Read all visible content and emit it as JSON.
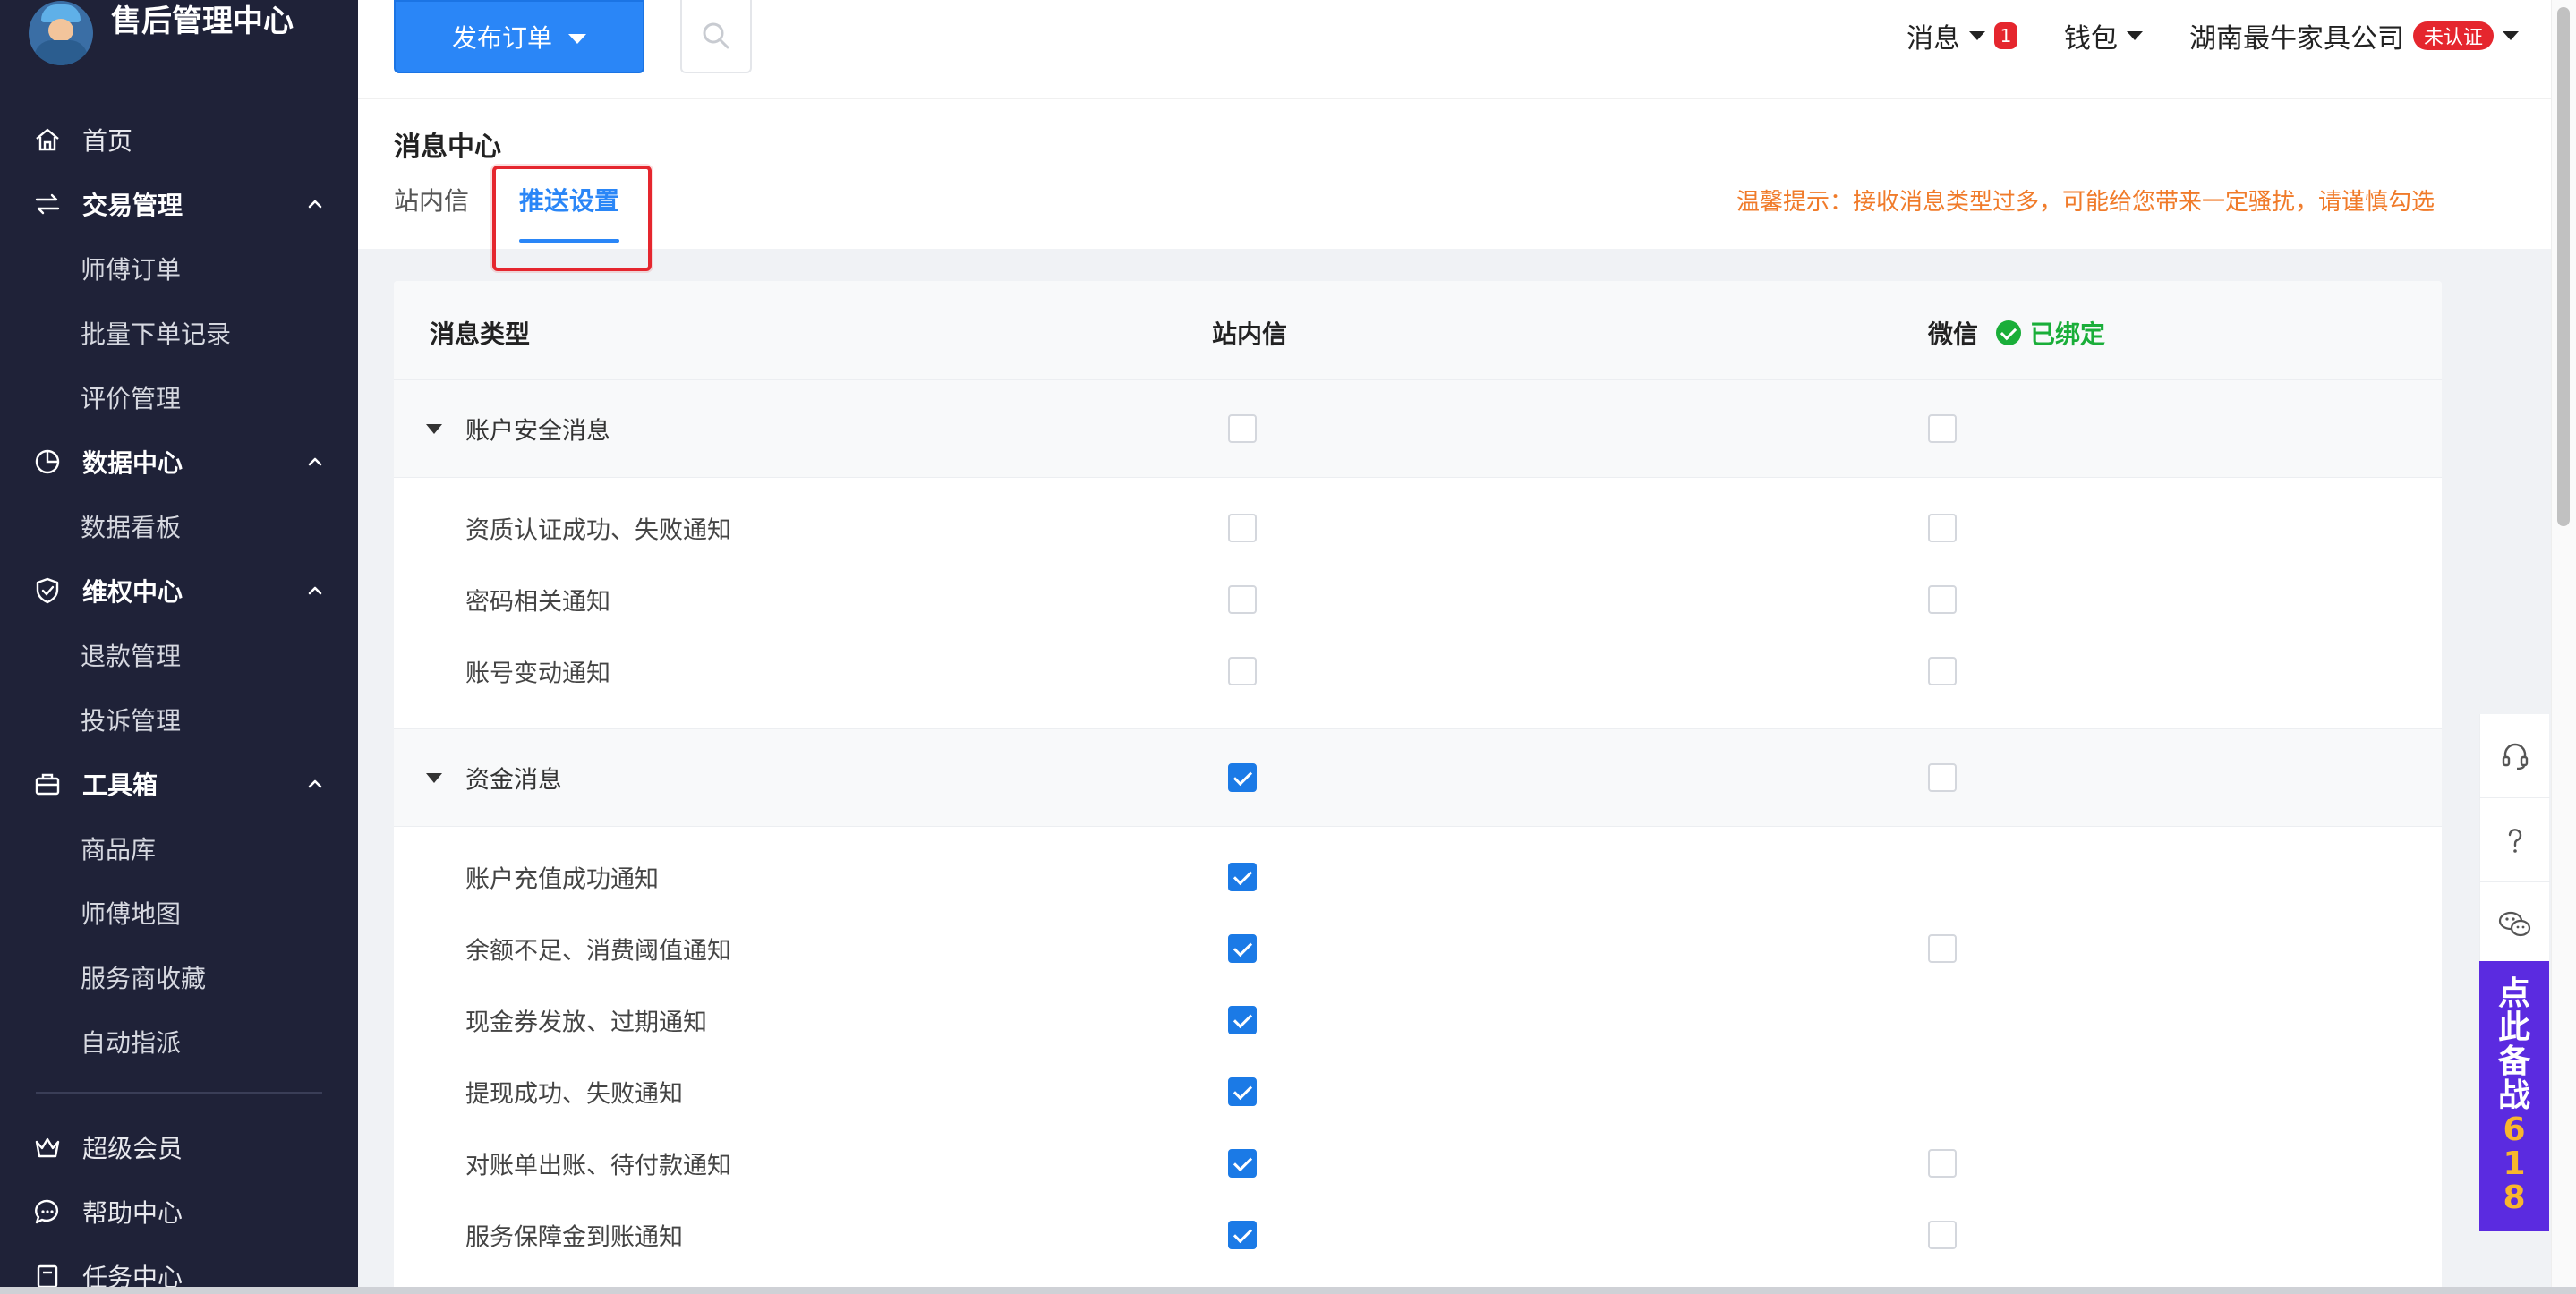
{
  "brand": {
    "title": "售后管理中心"
  },
  "sidebar": {
    "items": [
      {
        "type": "item",
        "label": "首页",
        "icon": "home-icon"
      },
      {
        "type": "group",
        "label": "交易管理",
        "icon": "exchange-icon"
      },
      {
        "type": "sub",
        "label": "师傅订单"
      },
      {
        "type": "sub",
        "label": "批量下单记录"
      },
      {
        "type": "sub",
        "label": "评价管理"
      },
      {
        "type": "group",
        "label": "数据中心",
        "icon": "pie-chart-icon"
      },
      {
        "type": "sub",
        "label": "数据看板"
      },
      {
        "type": "group",
        "label": "维权中心",
        "icon": "shield-icon"
      },
      {
        "type": "sub",
        "label": "退款管理"
      },
      {
        "type": "sub",
        "label": "投诉管理"
      },
      {
        "type": "group",
        "label": "工具箱",
        "icon": "toolbox-icon"
      },
      {
        "type": "sub",
        "label": "商品库"
      },
      {
        "type": "sub",
        "label": "师傅地图"
      },
      {
        "type": "sub",
        "label": "服务商收藏"
      },
      {
        "type": "sub",
        "label": "自动指派"
      },
      {
        "type": "divider"
      },
      {
        "type": "item",
        "label": "超级会员",
        "icon": "crown-icon"
      },
      {
        "type": "item",
        "label": "帮助中心",
        "icon": "chat-help-icon"
      },
      {
        "type": "item",
        "label": "任务中心",
        "icon": "task-icon"
      }
    ]
  },
  "topbar": {
    "publish_label": "发布订单",
    "messages_label": "消息",
    "messages_count": "1",
    "wallet_label": "钱包",
    "company_label": "湖南最牛家具公司",
    "unverified_label": "未认证"
  },
  "page": {
    "title": "消息中心",
    "tabs": [
      {
        "label": "站内信",
        "active": false
      },
      {
        "label": "推送设置",
        "active": true
      }
    ],
    "tip": "温馨提示：接收消息类型过多，可能给您带来一定骚扰，请谨慎勾选"
  },
  "table": {
    "headers": {
      "type": "消息类型",
      "site": "站内信",
      "wechat": "微信",
      "wechat_status": "已绑定"
    },
    "groups": [
      {
        "label": "账户安全消息",
        "site": false,
        "wechat": false,
        "items": [
          {
            "label": "资质认证成功、失败通知",
            "site": false,
            "wechat": false
          },
          {
            "label": "密码相关通知",
            "site": false,
            "wechat": false
          },
          {
            "label": "账号变动通知",
            "site": false,
            "wechat": false
          }
        ]
      },
      {
        "label": "资金消息",
        "site": true,
        "wechat": false,
        "items": [
          {
            "label": "账户充值成功通知",
            "site": true,
            "wechat": null
          },
          {
            "label": "余额不足、消费阈值通知",
            "site": true,
            "wechat": false
          },
          {
            "label": "现金券发放、过期通知",
            "site": true,
            "wechat": null
          },
          {
            "label": "提现成功、失败通知",
            "site": true,
            "wechat": null
          },
          {
            "label": "对账单出账、待付款通知",
            "site": true,
            "wechat": false
          },
          {
            "label": "服务保障金到账通知",
            "site": true,
            "wechat": false
          }
        ]
      }
    ]
  },
  "promo": {
    "chars": [
      "点",
      "此",
      "备",
      "战",
      "6",
      "1",
      "8"
    ]
  },
  "colors": {
    "primary": "#2a86f7",
    "sidebar_bg": "#1f2238",
    "danger": "#e5262e",
    "success": "#1aae39",
    "tip": "#f07b2a",
    "promo_bg": "#5b2be0"
  }
}
